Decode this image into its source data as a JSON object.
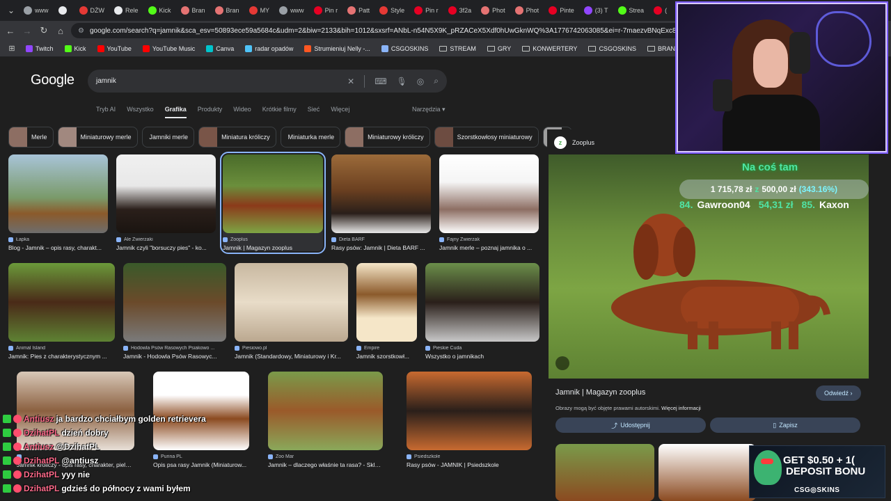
{
  "tabs": [
    {
      "label": "www",
      "color": "#9aa0a6"
    },
    {
      "label": "",
      "color": "#e8eaed"
    },
    {
      "label": "DŻW",
      "color": "#e53935"
    },
    {
      "label": "Rele",
      "color": "#e8eaed"
    },
    {
      "label": "Kick",
      "color": "#53fc18"
    },
    {
      "label": "Bran",
      "color": "#e57373"
    },
    {
      "label": "Bran",
      "color": "#e57373"
    },
    {
      "label": "MY",
      "color": "#e53935"
    },
    {
      "label": "www",
      "color": "#9aa0a6"
    },
    {
      "label": "Pin r",
      "color": "#e60023"
    },
    {
      "label": "Patt",
      "color": "#e57373"
    },
    {
      "label": "Style",
      "color": "#e53935"
    },
    {
      "label": "Pin r",
      "color": "#e60023"
    },
    {
      "label": "3f2a",
      "color": "#e60023"
    },
    {
      "label": "Phot",
      "color": "#e57373"
    },
    {
      "label": "Phot",
      "color": "#e57373"
    },
    {
      "label": "Pinte",
      "color": "#e60023"
    },
    {
      "label": "(3) T",
      "color": "#9146ff"
    },
    {
      "label": "Strea",
      "color": "#53fc18"
    },
    {
      "label": "(",
      "color": "#e60023"
    }
  ],
  "address": {
    "url": "google.com/search?q=jamnik&sca_esv=50893ece59a5684c&udm=2&biw=2133&bih=1012&sxsrf=ANbL-n54N5X9K_pRZACeX5Xdf0hUwGknWQ%3A1776742063085&ei=r-7maezvBNqExc8P1NGEiAk&ved"
  },
  "bookmarks": [
    {
      "label": "Twitch",
      "color": "#9146ff",
      "folder": false
    },
    {
      "label": "Kick",
      "color": "#53fc18",
      "folder": false
    },
    {
      "label": "YouTube",
      "color": "#ff0000",
      "folder": false
    },
    {
      "label": "YouTube Music",
      "color": "#ff0000",
      "folder": false
    },
    {
      "label": "Canva",
      "color": "#00c4cc",
      "folder": false
    },
    {
      "label": "radar opadów",
      "color": "#4fc3f7",
      "folder": false
    },
    {
      "label": "Strumieniuj Nelly -...",
      "color": "#ff5722",
      "folder": false
    },
    {
      "label": "CSGOSKINS",
      "color": "#8ab4f8",
      "folder": false
    },
    {
      "label": "STREAM",
      "color": "",
      "folder": true
    },
    {
      "label": "GRY",
      "color": "",
      "folder": true
    },
    {
      "label": "KONWERTERY",
      "color": "",
      "folder": true
    },
    {
      "label": "CSGOSKINS",
      "color": "",
      "folder": true
    },
    {
      "label": "BRANSOLETKI",
      "color": "",
      "folder": true
    },
    {
      "label": "Ustawienia strumien...",
      "color": "#e53935",
      "folder": false
    }
  ],
  "google": {
    "logo": "Google",
    "query": "jamnik",
    "tabs": [
      "Tryb AI",
      "Wszystko",
      "Grafika",
      "Produkty",
      "Wideo",
      "Krótkie filmy",
      "Sieć",
      "Więcej"
    ],
    "active_tab": "Grafika",
    "tools": "Narzędzia"
  },
  "chips": [
    {
      "label": "Merle",
      "thumb": "#8d6e63"
    },
    {
      "label": "Miniaturowy merle",
      "thumb": "#a1887f"
    },
    {
      "label": "Jamniki merle",
      "thumb": ""
    },
    {
      "label": "Miniatura króliczy",
      "thumb": "#795548"
    },
    {
      "label": "Miniaturka merle",
      "thumb": ""
    },
    {
      "label": "Miniaturowy króliczy",
      "thumb": "#8d6e63"
    },
    {
      "label": "Szorstkowłosy miniaturowy",
      "thumb": "#6d4c41"
    },
    {
      "label": "",
      "thumb": "#9e9e9e"
    }
  ],
  "images_row1": [
    {
      "source": "Łapka",
      "title": "Blog - Jamnik – opis rasy, charakt...",
      "bg": "linear-gradient(180deg,#a8c4d8 0%,#7a9a6a 55%,#8b5a2b 75%,#6d6d6d 100%)"
    },
    {
      "source": "Ale Zwierzaki",
      "title": "Jamnik czyli \"borsuczy pies\" - ko...",
      "bg": "linear-gradient(180deg,#f0f0f0 0%,#e8e8e8 40%,#2a1f1a 70%,#1a1410 100%)"
    },
    {
      "source": "Zooplus",
      "title": "Jamnik | Magazyn zooplus",
      "bg": "linear-gradient(180deg,#4a6b2a 0%,#6b8f3c 40%,#8b3a1a 65%,#7da544 100%)"
    },
    {
      "source": "Dieta BARF",
      "title": "Rasy psów: Jamnik | Dieta BARF ...",
      "bg": "linear-gradient(180deg,#9c6b3a 0%,#6b4020 45%,#2a1f1a 75%,#e8e8e8 100%)"
    },
    {
      "source": "Fajny Zwierzak",
      "title": "Jamnik merle – poznaj jamnika o ...",
      "bg": "linear-gradient(180deg,#ffffff 0%,#f5f5f5 35%,#8d6e63 70%,#ffffff 100%)"
    }
  ],
  "images_row2": [
    {
      "source": "Animal Island",
      "title": "Jamnik: Pies z charakterystycznym ...",
      "bg": "linear-gradient(180deg,#6b9a3a 0%,#4a2a18 50%,#5e8233 100%)"
    },
    {
      "source": "Hodowla Psów Rasowych Psiakowo ...",
      "title": "Jamnik - Hodowla Psów Rasowyc...",
      "bg": "linear-gradient(180deg,#3a5a2a 0%,#6b4a2a 50%,#7a7a7a 100%)"
    },
    {
      "source": "Piesiowo.pl",
      "title": "Jamnik (Standardowy, Miniaturowy i Kr...",
      "bg": "linear-gradient(180deg,#c8b8a0 0%,#e8dcc8 50%,#bba890 100%)"
    },
    {
      "source": "Empire",
      "title": "Jamnik szorstkowł...",
      "bg": "linear-gradient(180deg,#f5e6c8 0%,#8b5a2b 40%,#f5e6c8 70%,#f5e6c8 100%)"
    },
    {
      "source": "Pieskie Cuda",
      "title": "Wszystko o jamnikach",
      "bg": "linear-gradient(180deg,#6b8f4a 0%,#2a1f1a 50%,#c8c8c8 100%)"
    }
  ],
  "images_row3": [
    {
      "source": "",
      "title": "Jamnik króliczy - opis rasy, charakter, pielęgnacja",
      "bg": "linear-gradient(180deg,#d8c8b8 0%,#8b6040 50%,#e8e0d8 100%)"
    },
    {
      "source": "Purina PL",
      "title": "Opis psa rasy Jamnik (Miniaturow...",
      "bg": "linear-gradient(180deg,#ffffff 0%,#ffffff 30%,#8b4a20 60%,#ffffff 100%)"
    },
    {
      "source": "Zoo Mar",
      "title": "Jamnik – dlaczego właśnie ta rasa? - Sklep z...",
      "bg": "linear-gradient(180deg,#7a9a4a 0%,#9a5a2a 50%,#8aa85a 100%)"
    },
    {
      "source": "Psiedszkole",
      "title": "Rasy psów - JAMNIK | Psiedszkole",
      "bg": "linear-gradient(180deg,#c86a30 0%,#2a1f1a 50%,#c86a30 100%)"
    }
  ],
  "panel": {
    "source": "Zooplus",
    "title": "Jamnik | Magazyn zooplus",
    "visit": "Odwiedź",
    "notice": "Obrazy mogą być objęte prawami autorskimi.",
    "notice_link": "Więcej informacji",
    "share": "Udostępnij",
    "save": "Zapisz"
  },
  "overlay": {
    "title": "Na coś tam",
    "amount": "1 715,78 zł",
    "sep": "z",
    "goal": "500,00 zł",
    "percent": "(343.16%)",
    "rank1_num": "84.",
    "rank1_user": "Gawroon04",
    "rank1_value": "54,31 zł",
    "rank2_num": "85.",
    "rank2_user": "Kaxon"
  },
  "chat": [
    {
      "user": "Antiusz",
      "message": "ja bardzo chciałbym golden retrievera"
    },
    {
      "user": "DzihatPL",
      "message": "dzień dobry"
    },
    {
      "user": "Antiusz",
      "message": "@DzihatPL"
    },
    {
      "user": "DzihatPL",
      "message": "@antiusz"
    },
    {
      "user": "DzihatPL",
      "message": "yyy nie"
    },
    {
      "user": "DzihatPL",
      "message": "gdzieś do północy z wami byłem"
    }
  ],
  "ad": {
    "line1": "GET $0.50 + 1(",
    "line2": "DEPOSIT BONU",
    "brand": "CSG◎SKINS"
  }
}
